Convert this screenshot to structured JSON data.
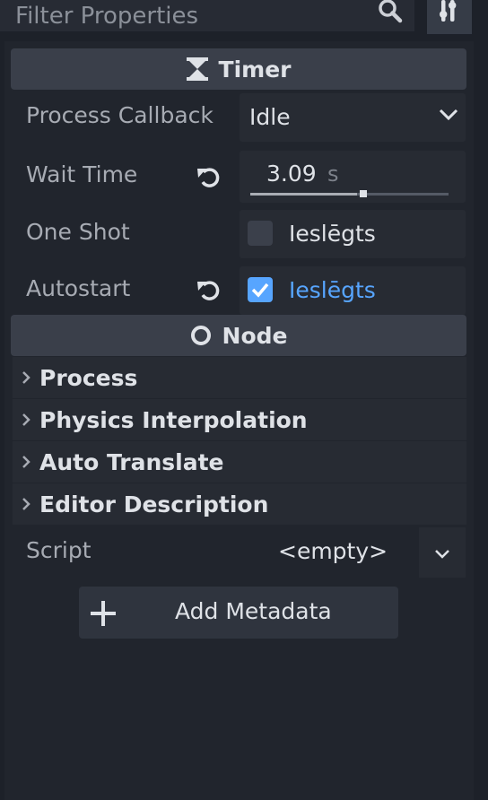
{
  "filter": {
    "placeholder": "Filter Properties",
    "search_icon": "search-icon",
    "tools_icon": "tools-icon"
  },
  "timer_section": {
    "title": "Timer",
    "icon": "hourglass-icon",
    "process_callback": {
      "label": "Process Callback",
      "value": "Idle"
    },
    "wait_time": {
      "label": "Wait Time",
      "value": "3.09",
      "unit": "s",
      "slider_fraction": 0.54
    },
    "one_shot": {
      "label": "One Shot",
      "checked": false,
      "value": "Ieslēgts"
    },
    "autostart": {
      "label": "Autostart",
      "checked": true,
      "value": "Ieslēgts"
    }
  },
  "node_section": {
    "title": "Node",
    "icon": "circle-node-icon",
    "groups": [
      {
        "label": "Process"
      },
      {
        "label": "Physics Interpolation"
      },
      {
        "label": "Auto Translate"
      },
      {
        "label": "Editor Description"
      }
    ]
  },
  "script": {
    "label": "Script",
    "value": "<empty>"
  },
  "add_metadata": {
    "label": "Add Metadata"
  },
  "colors": {
    "accent": "#57a5ff",
    "panel": "#21252d",
    "header": "#3a3f4a"
  }
}
